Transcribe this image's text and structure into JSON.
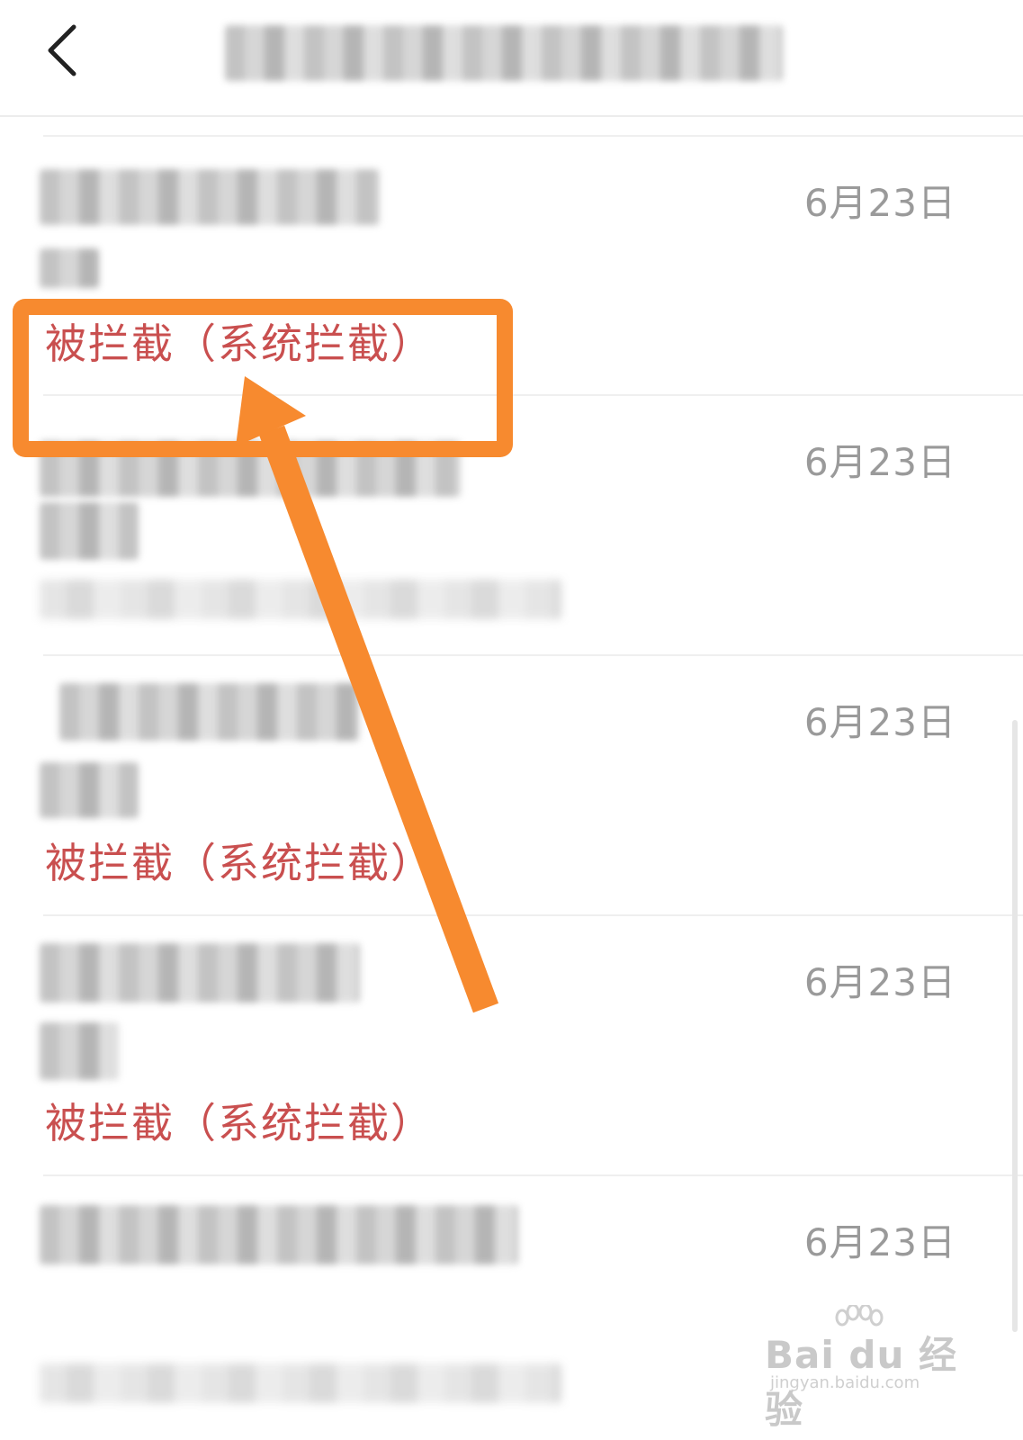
{
  "header": {
    "back_icon": "chevron-left-icon"
  },
  "messages": [
    {
      "date": "6月23日",
      "status": "被拦截（系统拦截）"
    },
    {
      "date": "6月23日",
      "status": ""
    },
    {
      "date": "6月23日",
      "status": "被拦截（系统拦截）"
    },
    {
      "date": "6月23日",
      "status": "被拦截（系统拦截）"
    },
    {
      "date": "6月23日",
      "status": ""
    }
  ],
  "annotation": {
    "color": "#f78a2f"
  },
  "status_color": "#c94f4f",
  "watermark": {
    "brand": "Bai du 经验",
    "url": "jingyan.baidu.com"
  }
}
